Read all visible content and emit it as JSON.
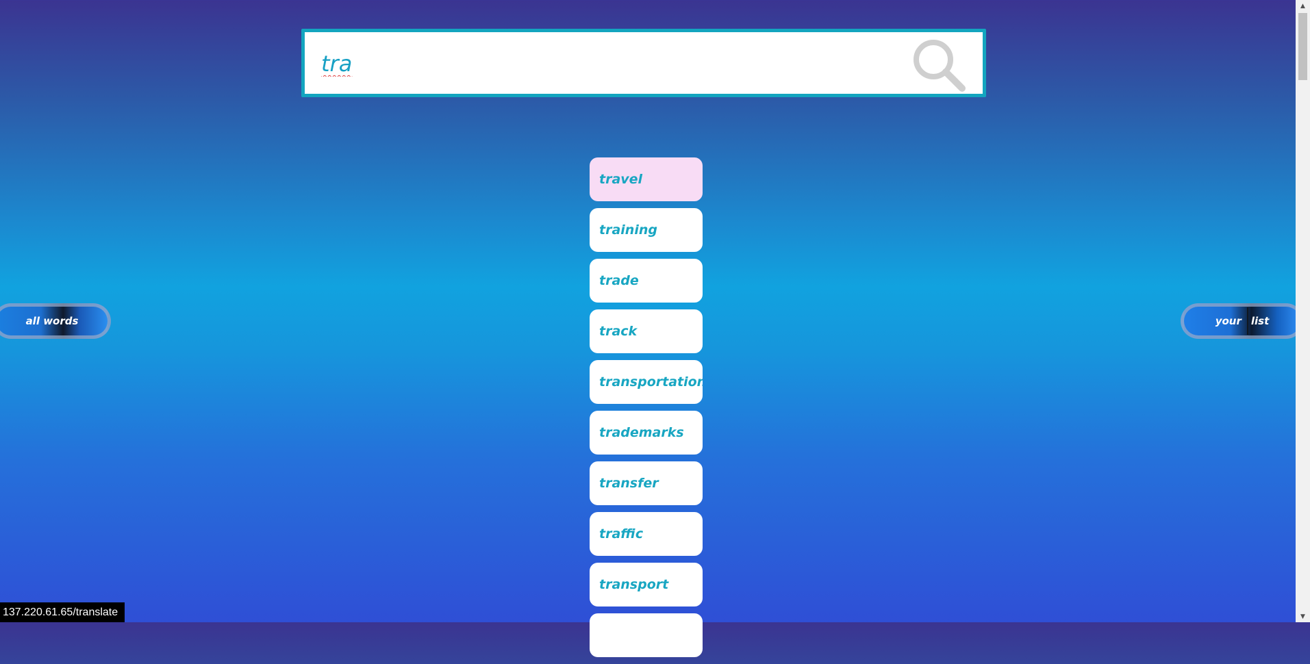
{
  "search": {
    "value": "tra",
    "icon": "magnifier-icon"
  },
  "suggestions": [
    {
      "label": "travel",
      "active": true
    },
    {
      "label": "training"
    },
    {
      "label": "trade"
    },
    {
      "label": "track"
    },
    {
      "label": "transportation"
    },
    {
      "label": "trademarks"
    },
    {
      "label": "transfer"
    },
    {
      "label": "traffic"
    },
    {
      "label": "transport"
    },
    {
      "label": ""
    }
  ],
  "nav": {
    "left_label": "all words",
    "right_label_1": "your",
    "right_label_2": "list"
  },
  "status_bar": {
    "url": "137.220.61.65/translate"
  },
  "scrollbar": {
    "up_icon": "▲",
    "down_icon": "▼"
  },
  "colors": {
    "accent": "#13a5bf",
    "active_suggestion": "#f8dcf5",
    "text": "#18a6c2"
  }
}
